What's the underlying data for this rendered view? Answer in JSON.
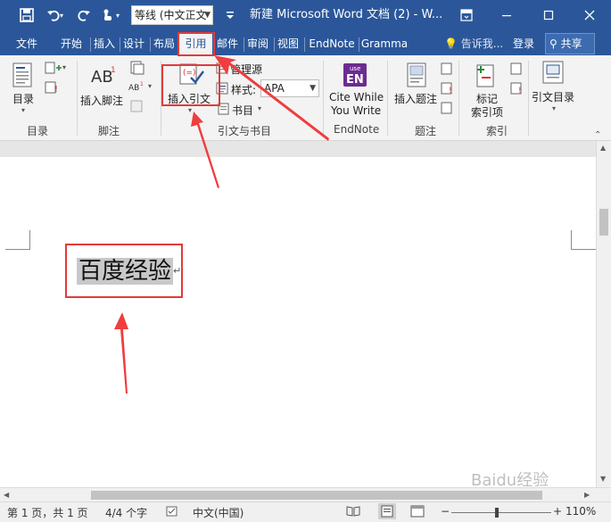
{
  "titlebar": {
    "font_name": "等线 (中文正文",
    "title": "新建 Microsoft Word 文档 (2) - W...",
    "icons": [
      "save-icon",
      "undo-icon",
      "redo-icon",
      "touch-mode-icon",
      "customize-qat-icon",
      "ribbon-display-icon",
      "minimize-icon",
      "maximize-icon",
      "close-icon"
    ]
  },
  "tabs": {
    "file": "文件",
    "home": "开始",
    "insert": "插入",
    "design": "设计",
    "layout": "布局",
    "references": "引用",
    "mailings": "邮件",
    "review": "审阅",
    "view": "视图",
    "endnote": "EndNote",
    "grammarly": "Gramma",
    "tell_me": "告诉我...",
    "login": "登录",
    "share": "共享"
  },
  "ribbon": {
    "toc": {
      "button": "目录",
      "group": "目录"
    },
    "footnotes": {
      "insert_footnote": "插入脚注",
      "group": "脚注"
    },
    "citations": {
      "insert_citation": "插入引文",
      "manage_sources": "管理源",
      "style_label": "样式:",
      "style_value": "APA",
      "bibliography": "书目",
      "group": "引文与书目"
    },
    "endnote": {
      "badge_top": "use",
      "badge_main": "EN",
      "line1": "Cite While",
      "line2": "You Write",
      "group": "EndNote"
    },
    "captions": {
      "insert_caption": "插入题注",
      "group": "题注"
    },
    "index": {
      "mark_entry_line1": "标记",
      "mark_entry_line2": "索引项",
      "group": "索引"
    },
    "toa": {
      "label": "引文目录"
    }
  },
  "document": {
    "text": "百度经验",
    "para_mark": "↵"
  },
  "statusbar": {
    "page": "第 1 页，共 1 页",
    "words": "4/4 个字",
    "language": "中文(中国)",
    "zoom": "110%",
    "zoom_percent": 110
  },
  "watermark": "Baidu经验",
  "colors": {
    "title_blue": "#2b579a",
    "annotation_red": "#e33a3a"
  }
}
